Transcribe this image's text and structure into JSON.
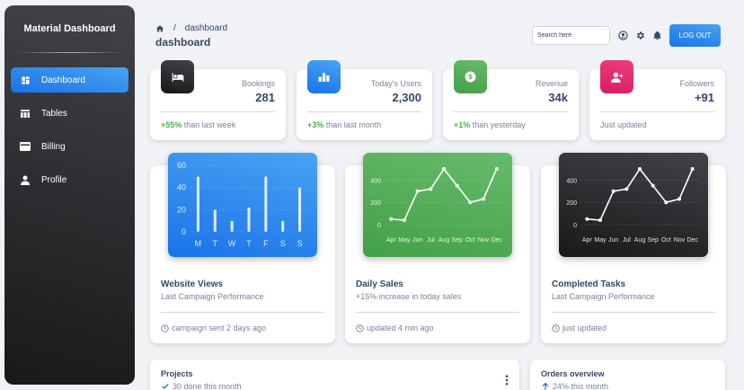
{
  "sidebar": {
    "brand": "Material Dashboard",
    "items": [
      {
        "label": "Dashboard",
        "icon": "dashboard-icon",
        "active": true
      },
      {
        "label": "Tables",
        "icon": "table-icon"
      },
      {
        "label": "Billing",
        "icon": "billing-icon"
      },
      {
        "label": "Profile",
        "icon": "person-icon"
      }
    ]
  },
  "header": {
    "breadcrumb_sep": "/",
    "breadcrumb_current": "dashboard",
    "title": "dashboard",
    "search_placeholder": "Search here",
    "logout_label": "LOG OUT"
  },
  "stats": [
    {
      "label": "Bookings",
      "value": "281",
      "change": "+55%",
      "foot": " than last week",
      "icon": "bed-icon",
      "color": "#191919"
    },
    {
      "label": "Today's Users",
      "value": "2,300",
      "change": "+3%",
      "foot": " than last month",
      "icon": "leaderboard-icon",
      "color": "#1A73E8"
    },
    {
      "label": "Revenue",
      "value": "34k",
      "change": "+1%",
      "foot": " than yesterday",
      "icon": "money-icon",
      "color": "#4caf50"
    },
    {
      "label": "Followers",
      "value": "+91",
      "change": "",
      "foot": "Just updated",
      "icon": "person-add-icon",
      "color": "#e91e63"
    }
  ],
  "cards": [
    {
      "title": "Website Views",
      "subtitle": "Last Campaign Performance",
      "footer": "campaign sent 2 days ago"
    },
    {
      "title": "Daily Sales",
      "subtitle": "+15% increase in today sales",
      "footer": "updated 4 min ago"
    },
    {
      "title": "Completed Tasks",
      "subtitle": "Last Campaign Performance",
      "footer": "just updated"
    }
  ],
  "bottom": {
    "projects": {
      "title": "Projects",
      "subtitle": "30 done this month"
    },
    "orders": {
      "title": "Orders overview",
      "subtitle": "24% this month"
    }
  },
  "chart_data": [
    {
      "type": "bar",
      "categories": [
        "M",
        "T",
        "W",
        "T",
        "F",
        "S",
        "S"
      ],
      "values": [
        50,
        20,
        10,
        22,
        50,
        10,
        40
      ],
      "yticks": [
        0,
        20,
        40,
        60
      ],
      "ylim": [
        0,
        60
      ],
      "bg": "#1A73E8"
    },
    {
      "type": "line",
      "categories": [
        "Apr",
        "May",
        "Jun",
        "Jul",
        "Aug",
        "Sep",
        "Oct",
        "Nov",
        "Dec"
      ],
      "values": [
        50,
        40,
        300,
        320,
        500,
        350,
        200,
        230,
        500
      ],
      "yticks": [
        0,
        200,
        400
      ],
      "ylim": [
        0,
        500
      ],
      "bg": "#4caf50"
    },
    {
      "type": "line",
      "categories": [
        "Apr",
        "May",
        "Jun",
        "Jul",
        "Aug",
        "Sep",
        "Oct",
        "Nov",
        "Dec"
      ],
      "values": [
        50,
        40,
        300,
        320,
        500,
        350,
        200,
        230,
        500
      ],
      "yticks": [
        0,
        200,
        400
      ],
      "ylim": [
        0,
        500
      ],
      "bg": "#262626"
    }
  ]
}
